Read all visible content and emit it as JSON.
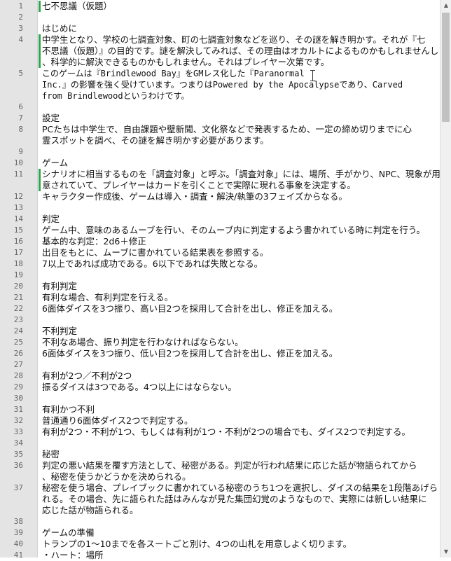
{
  "lines": [
    {
      "no": "1",
      "text": "七不思議（仮題）",
      "mod": true
    },
    {
      "no": "2",
      "text": ""
    },
    {
      "no": "3",
      "text": "はじめに"
    },
    {
      "no": "4",
      "text": "中学生となり、学校の七調査対象、町の七調査対象などを巡り、その謎を解き明かす。それが『七",
      "mod": true
    },
    {
      "no": "",
      "text": "不思議（仮題）』の目的です。謎を解決してみれば、その理由はオカルトによるものかもしれませんし",
      "mod": true
    },
    {
      "no": "",
      "text": "、科学的に解決できるものかもしれません。それはプレイヤー次第です。",
      "mod": true
    },
    {
      "no": "5",
      "text": "このゲームは『Brindlewood Bay』をGMレス化した『Paranormal",
      "mono": true
    },
    {
      "no": "",
      "text": "Inc.』の影響を強く受けています。つまりはPowered by the Apocalypseであり、Carved",
      "mono": true
    },
    {
      "no": "",
      "text": "from Brindlewoodというわけです。",
      "mono": true
    },
    {
      "no": "6",
      "text": ""
    },
    {
      "no": "7",
      "text": "設定"
    },
    {
      "no": "8",
      "text": "PCたちは中学生で、自由課題や壁新聞、文化祭などで発表するため、一定の締め切りまでに心"
    },
    {
      "no": "",
      "text": "霊スポットを調べ、その謎を解き明かす必要があります。"
    },
    {
      "no": "9",
      "text": ""
    },
    {
      "no": "10",
      "text": "ゲーム"
    },
    {
      "no": "11",
      "text": "シナリオに相当するものを「調査対象」と呼ぶ。「調査対象」には、場所、手がかり、NPC、現象が用",
      "mod": true
    },
    {
      "no": "",
      "text": "意されていて、プレイヤーはカードを引くことで実際に現れる事象を決定する。",
      "mod": true
    },
    {
      "no": "12",
      "text": "キャラクター作成後、ゲームは導入・調査・解決/執筆の3フェイズからなる。"
    },
    {
      "no": "13",
      "text": ""
    },
    {
      "no": "14",
      "text": "判定"
    },
    {
      "no": "15",
      "text": "ゲーム中、意味のあるムーブを行い、そのムーブ内に判定するよう書かれている時に判定を行う。"
    },
    {
      "no": "16",
      "text": "基本的な判定：2d6＋修正"
    },
    {
      "no": "17",
      "text": "出目をもとに、ムーブに書かれている結果表を参照する。"
    },
    {
      "no": "18",
      "text": "7以上であれば成功である。6以下であれば失敗となる。"
    },
    {
      "no": "19",
      "text": ""
    },
    {
      "no": "20",
      "text": "有利判定"
    },
    {
      "no": "21",
      "text": "有利な場合、有利判定を行える。"
    },
    {
      "no": "22",
      "text": "6面体ダイスを3つ振り、高い目2つを採用して合計を出し、修正を加える。"
    },
    {
      "no": "23",
      "text": ""
    },
    {
      "no": "24",
      "text": "不利判定"
    },
    {
      "no": "25",
      "text": "不利なあ場合、振り判定を行わなければならない。"
    },
    {
      "no": "26",
      "text": "6面体ダイスを3つ振り、低い目2つを採用して合計を出し、修正を加える。"
    },
    {
      "no": "27",
      "text": ""
    },
    {
      "no": "28",
      "text": "有利が2つ／不利が2つ"
    },
    {
      "no": "29",
      "text": "振るダイスは3つである。4つ以上にはならない。"
    },
    {
      "no": "30",
      "text": ""
    },
    {
      "no": "31",
      "text": "有利かつ不利"
    },
    {
      "no": "32",
      "text": "普通通り6面体ダイス2つで判定する。"
    },
    {
      "no": "33",
      "text": "有利が2つ・不利が1つ、もしくは有利が1つ・不利が2つの場合でも、ダイス2つで判定する。"
    },
    {
      "no": "34",
      "text": ""
    },
    {
      "no": "35",
      "text": "秘密"
    },
    {
      "no": "36",
      "text": "判定の悪い結果を覆す方法として、秘密がある。判定が行われ結果に応じた話が物語られてから"
    },
    {
      "no": "",
      "text": "、秘密を使うかどうかを決められる。"
    },
    {
      "no": "37",
      "text": "秘密を使う場合、プレイブックに書かれている秘密のうち1つを選択し、ダイスの結果を1段階あげら"
    },
    {
      "no": "",
      "text": "れる。その場合、先に語られた話はみんなが見た集団幻覚のようなもので、実際には新しい結果に"
    },
    {
      "no": "",
      "text": "応じた話が物語られる。"
    },
    {
      "no": "38",
      "text": ""
    },
    {
      "no": "39",
      "text": "ゲームの準備"
    },
    {
      "no": "40",
      "text": "トランプの1～10までを各スートごと別け、4つの山札を用意しよく切ります。"
    },
    {
      "no": "41",
      "text": "・ハート：場所"
    }
  ],
  "scrollbar": {
    "up_arrow": "▲",
    "down_arrow": "▼"
  },
  "colors": {
    "modified_marker": "#2ea44f",
    "gutter": "#e4e4e4",
    "line_number": "#666666"
  }
}
